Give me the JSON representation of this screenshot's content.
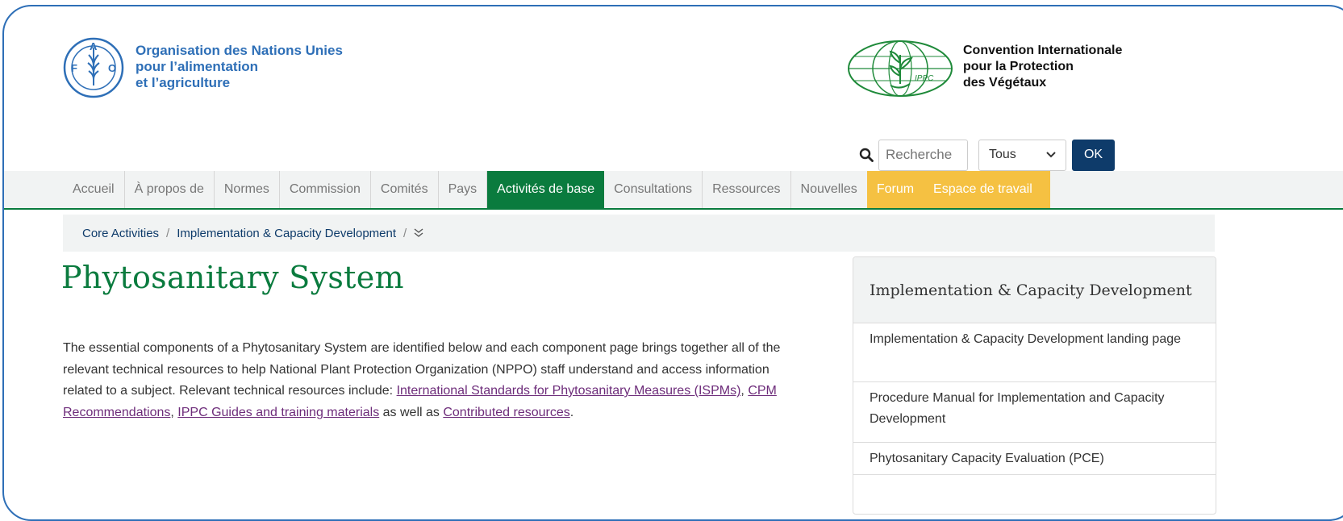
{
  "header": {
    "fao": {
      "logo_letters": [
        "F",
        "A",
        "O"
      ],
      "line1": "Organisation des Nations Unies",
      "line2": "pour l’alimentation",
      "line3": "et l’agriculture"
    },
    "ippc": {
      "logo_text": "IPPC",
      "line1": "Convention Internationale",
      "line2": "pour la Protection",
      "line3": "des Végétaux"
    }
  },
  "search": {
    "placeholder": "Recherche",
    "scope_selected": "Tous",
    "submit_label": "OK"
  },
  "nav": {
    "items": [
      {
        "label": "Accueil",
        "state": "normal"
      },
      {
        "label": "À propos de",
        "state": "normal"
      },
      {
        "label": "Normes",
        "state": "normal"
      },
      {
        "label": "Commission",
        "state": "normal"
      },
      {
        "label": "Comités",
        "state": "normal"
      },
      {
        "label": "Pays",
        "state": "normal"
      },
      {
        "label": "Activités de base",
        "state": "active"
      },
      {
        "label": "Consultations",
        "state": "normal"
      },
      {
        "label": "Ressources",
        "state": "normal"
      },
      {
        "label": "Nouvelles",
        "state": "normal"
      },
      {
        "label": "Forum",
        "state": "highlight"
      },
      {
        "label": "Espace de travail",
        "state": "highlight"
      }
    ]
  },
  "breadcrumb": {
    "items": [
      "Core Activities",
      "Implementation & Capacity Development"
    ],
    "separator": "/",
    "more_icon": "double-chevron-down"
  },
  "page": {
    "title": "Phytosanitary System",
    "intro_text": "The essential components of a Phytosanitary System are identified below and each component page brings together all of the relevant technical resources to help National Plant Protection Organization (NPPO) staff understand and access information related to a subject. Relevant technical resources include: ",
    "link_ispm": "International Standards for Phytosanitary Measures (ISPMs)",
    "comma1": ", ",
    "link_cpm": "CPM Recommendations",
    "comma2": ", ",
    "link_guides": "IPPC Guides and training materials",
    "as_well_as": " as well as ",
    "link_contributed": "Contributed resources",
    "period": "."
  },
  "sidebar": {
    "title": "Implementation & Capacity Development",
    "items": [
      {
        "label": "Implementation & Capacity Development landing page"
      },
      {
        "label": "Procedure Manual for Implementation and Capacity Development"
      },
      {
        "label": "Phytosanitary Capacity Evaluation (PCE)"
      }
    ]
  },
  "colors": {
    "brand_green": "#0a7b3e",
    "fao_blue": "#2e6fb7",
    "forum_yellow": "#f5c142",
    "ok_button": "#0e3b6a",
    "link_purple": "#6d2c7a"
  }
}
